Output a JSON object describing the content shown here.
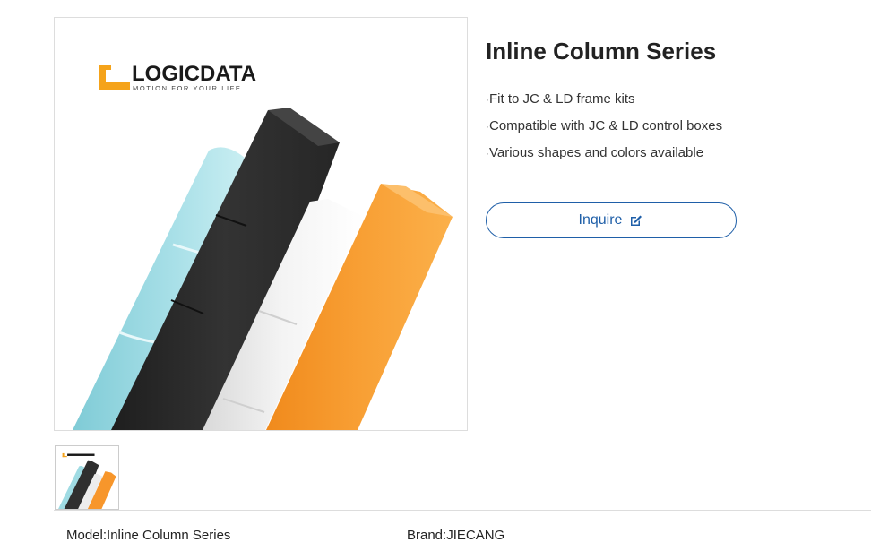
{
  "product": {
    "title": "Inline Column Series",
    "features": [
      "Fit to JC & LD frame kits",
      "Compatible with JC & LD control boxes",
      "Various shapes and colors available"
    ],
    "bullet_char": "·",
    "inquire_label": "Inquire",
    "inquire_icon": "edit-icon"
  },
  "image": {
    "logo_text": "LOGICDATA",
    "logo_tagline": "MOTION FOR YOUR LIFE",
    "column_colors": [
      "#9fdbe3",
      "#2f2f2f",
      "#ededed",
      "#f7962b"
    ],
    "brand_color": "#f5a31a"
  },
  "specs": {
    "model_label": "Model:",
    "model_value": "Inline Column Series",
    "brand_label": "Brand:",
    "brand_value": "JIECANG"
  },
  "colors": {
    "accent": "#1f5fa8",
    "border": "#dddddd"
  }
}
